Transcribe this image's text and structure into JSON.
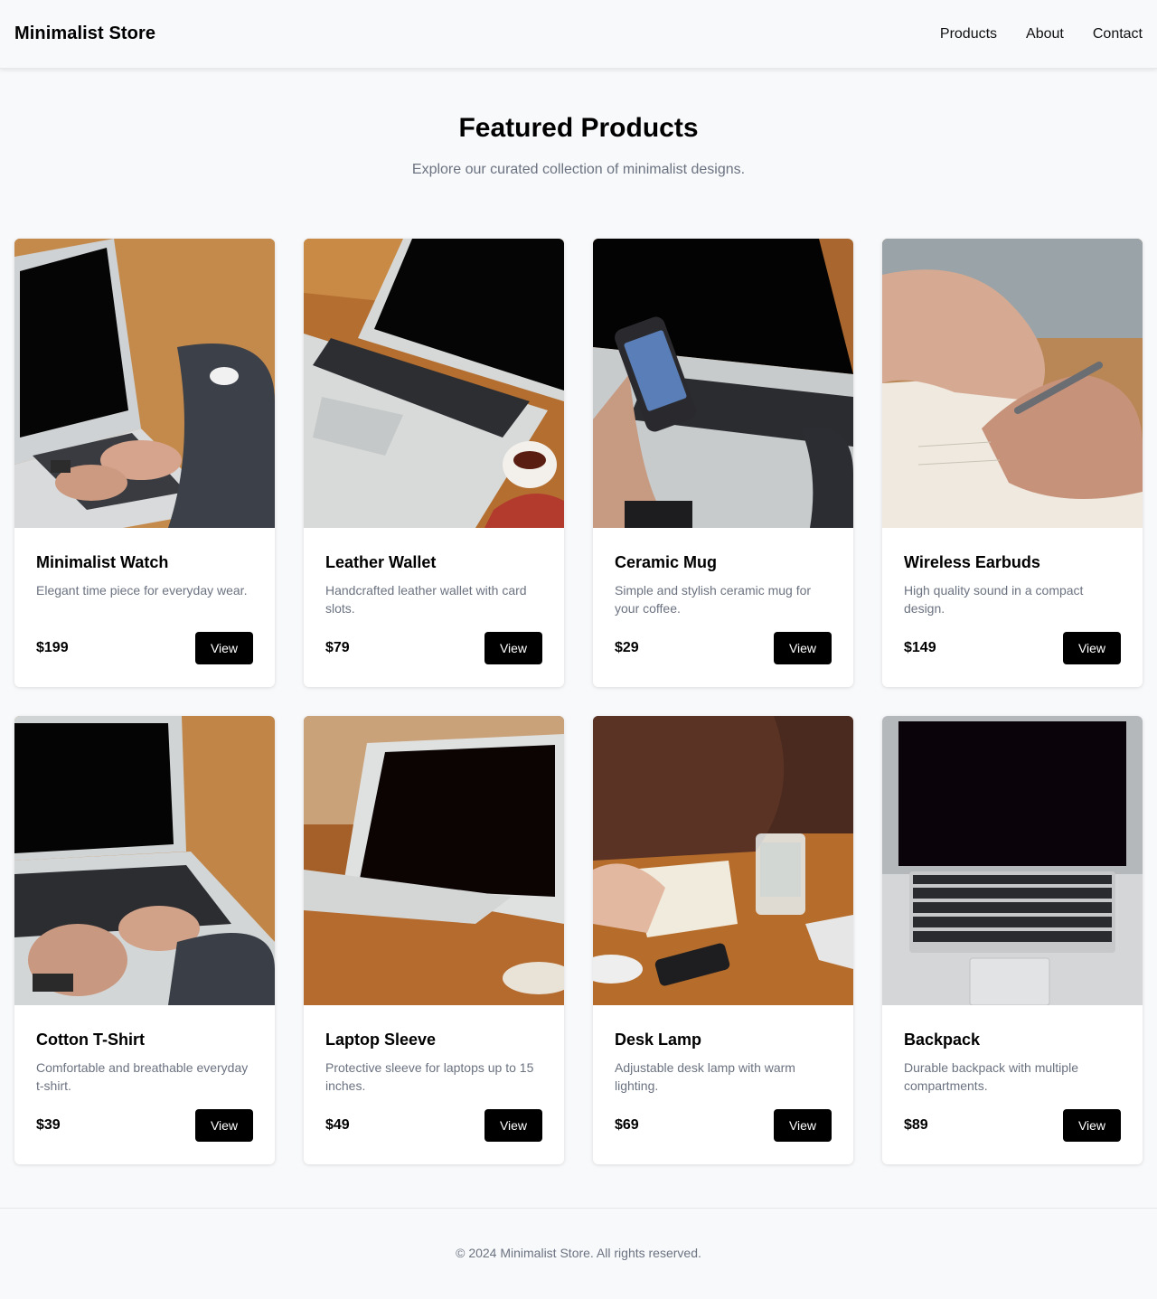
{
  "header": {
    "brand": "Minimalist Store",
    "nav": [
      "Products",
      "About",
      "Contact"
    ]
  },
  "hero": {
    "title": "Featured Products",
    "subtitle": "Explore our curated collection of minimalist designs."
  },
  "products": [
    {
      "name": "Minimalist Watch",
      "description": "Elegant time piece for everyday wear.",
      "price": "$199",
      "button": "View"
    },
    {
      "name": "Leather Wallet",
      "description": "Handcrafted leather wallet with card slots.",
      "price": "$79",
      "button": "View"
    },
    {
      "name": "Ceramic Mug",
      "description": "Simple and stylish ceramic mug for your coffee.",
      "price": "$29",
      "button": "View"
    },
    {
      "name": "Wireless Earbuds",
      "description": "High quality sound in a compact design.",
      "price": "$149",
      "button": "View"
    },
    {
      "name": "Cotton T-Shirt",
      "description": "Comfortable and breathable everyday t-shirt.",
      "price": "$39",
      "button": "View"
    },
    {
      "name": "Laptop Sleeve",
      "description": "Protective sleeve for laptops up to 15 inches.",
      "price": "$49",
      "button": "View"
    },
    {
      "name": "Desk Lamp",
      "description": "Adjustable desk lamp with warm lighting.",
      "price": "$69",
      "button": "View"
    },
    {
      "name": "Backpack",
      "description": "Durable backpack with multiple compartments.",
      "price": "$89",
      "button": "View"
    }
  ],
  "footer": {
    "text": "© 2024 Minimalist Store. All rights reserved."
  },
  "colors": {
    "page_background": "#f8f9fb",
    "button_background": "#000000",
    "muted_text": "#6b7280"
  }
}
